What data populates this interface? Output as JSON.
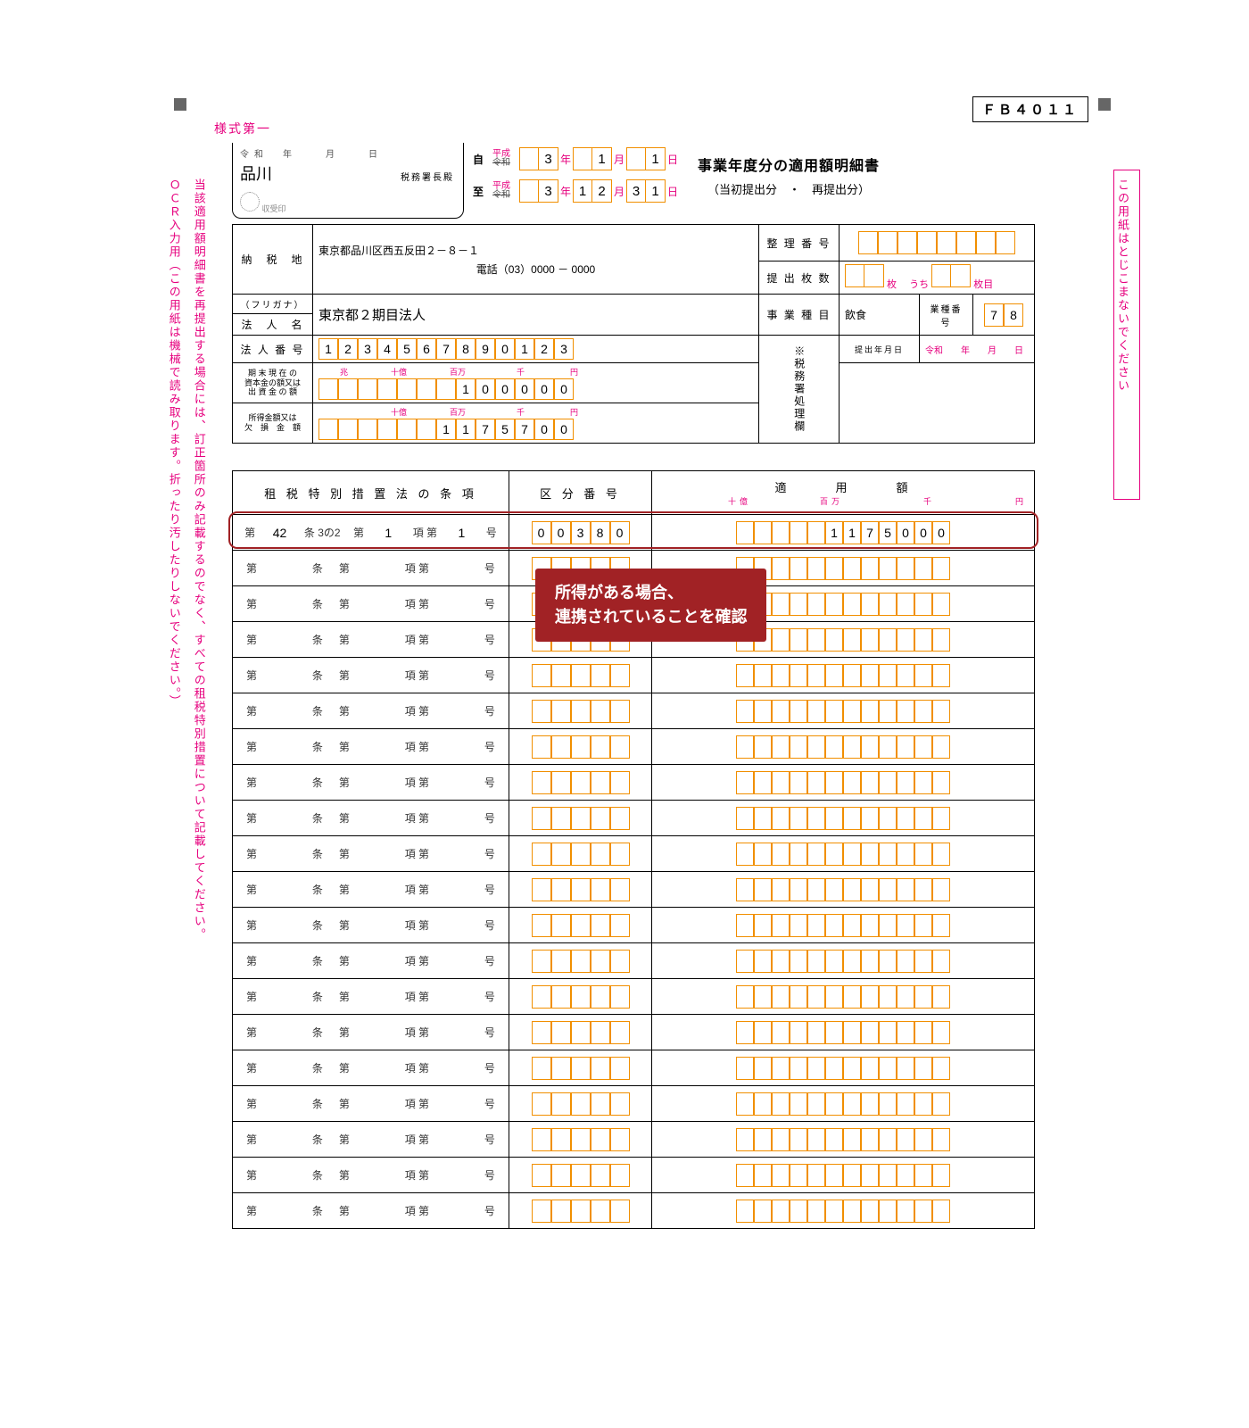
{
  "meta": {
    "form_id": "ＦＢ４０１１",
    "style_no": "様式第一"
  },
  "side_notes": {
    "left_line1": "当該適用額明細書を再提出する場合には、訂正箇所のみ記載するのでなく、すべての租税特別措置について記載してください。",
    "left_line2": "ＯＣＲ入力用（この用紙は機械で読み取ります。折ったり汚したりしないでください。）",
    "right": "この用紙はとじこまないでください"
  },
  "header": {
    "reiwa": "令和",
    "tiny_labels": "年　　月　　日",
    "office": "品川",
    "office_suffix": "税務署長殿",
    "stamp_label": "収受印",
    "from_label": "自",
    "to_label": "至",
    "era_heisei": "平成",
    "era_reiwa": "令和",
    "year_label": "年",
    "month_label": "月",
    "day_label": "日",
    "from": {
      "y1": "",
      "y2": "3",
      "m1": "",
      "m2": "1",
      "d1": "",
      "d2": "1"
    },
    "to": {
      "y1": "",
      "y2": "3",
      "m1": "1",
      "m2": "2",
      "d1": "3",
      "d2": "1"
    },
    "title": "事業年度分の適用額明細書",
    "subtitle": "（当初提出分　・　再提出分）"
  },
  "info": {
    "addr_label": "納　税　地",
    "address_line1": "東京都品川区西五反田２－８－１",
    "phone_label": "電話（",
    "phone_area": "03",
    "phone_mid": "）0000",
    "phone_dash": " － ",
    "phone_last": "0000",
    "furigana_label": "（フリガナ）",
    "furigana": "",
    "name_label": "法　人　名",
    "name": "東京都２期目法人",
    "corp_no_label": "法 人 番 号",
    "corp_no": [
      "1",
      "2",
      "3",
      "4",
      "5",
      "6",
      "7",
      "8",
      "9",
      "0",
      "1",
      "2",
      "3"
    ],
    "capital_label": "期 末 現 在 の\n資本金の額又は\n出 資 金 の 額",
    "capital_units": {
      "ju": "十億",
      "hyaku": "百万",
      "sen": "千",
      "en": "円",
      "oku": "兆"
    },
    "capital": [
      "",
      "",
      "",
      "",
      "",
      "",
      "",
      "1",
      "0",
      "0",
      "0",
      "0",
      "0"
    ],
    "income_label": "所得金額又は\n欠　損　金　額",
    "income": [
      "",
      "",
      "",
      "",
      "",
      "",
      "1",
      "1",
      "7",
      "5",
      "7",
      "0",
      "0"
    ],
    "docno_label": "整 理 番 号",
    "copies_label": "提 出 枚 数",
    "copies_unit1": "枚",
    "copies_uchi": "うち",
    "copies_unit2": "枚目",
    "biz_label": "事 業 種 目",
    "biz_value": "飲食",
    "biz_code_label": "業種番号",
    "biz_code": [
      "7",
      "8"
    ],
    "proc_label": "※税務署処理欄",
    "submit_date_label": "提出年月日",
    "submit_era": "令和",
    "submit_y": "年",
    "submit_m": "月",
    "submit_d": "日"
  },
  "lower": {
    "head_clause": "租 税 特 別 措 置 法 の 条 項",
    "head_kubun": "区 分 番 号",
    "head_amount": "適　　　用　　　額",
    "amount_units": [
      "十億",
      "百万",
      "千",
      "円"
    ],
    "clause_labels": {
      "dai1": "第",
      "jo": "条",
      "dai2": "第",
      "ko": "項 第",
      "go": "号"
    },
    "rows": [
      {
        "jo": "42",
        "jo_suffix": "3の2",
        "dai": "1",
        "ko": "1",
        "kubun": [
          "0",
          "0",
          "3",
          "8",
          "0"
        ],
        "amount": [
          "",
          "",
          "",
          "",
          "",
          "1",
          "1",
          "7",
          "5",
          "0",
          "0",
          "0"
        ]
      },
      {
        "jo": "",
        "jo_suffix": "",
        "dai": "",
        "ko": "",
        "kubun": [
          "",
          "",
          "",
          "",
          ""
        ],
        "amount": [
          "",
          "",
          "",
          "",
          "",
          "",
          "",
          "",
          "",
          "",
          "",
          ""
        ]
      },
      {
        "jo": "",
        "jo_suffix": "",
        "dai": "",
        "ko": "",
        "kubun": [
          "",
          "",
          "",
          "",
          ""
        ],
        "amount": [
          "",
          "",
          "",
          "",
          "",
          "",
          "",
          "",
          "",
          "",
          "",
          ""
        ]
      },
      {
        "jo": "",
        "jo_suffix": "",
        "dai": "",
        "ko": "",
        "kubun": [
          "",
          "",
          "",
          "",
          ""
        ],
        "amount": [
          "",
          "",
          "",
          "",
          "",
          "",
          "",
          "",
          "",
          "",
          "",
          ""
        ]
      },
      {
        "jo": "",
        "jo_suffix": "",
        "dai": "",
        "ko": "",
        "kubun": [
          "",
          "",
          "",
          "",
          ""
        ],
        "amount": [
          "",
          "",
          "",
          "",
          "",
          "",
          "",
          "",
          "",
          "",
          "",
          ""
        ]
      },
      {
        "jo": "",
        "jo_suffix": "",
        "dai": "",
        "ko": "",
        "kubun": [
          "",
          "",
          "",
          "",
          ""
        ],
        "amount": [
          "",
          "",
          "",
          "",
          "",
          "",
          "",
          "",
          "",
          "",
          "",
          ""
        ]
      },
      {
        "jo": "",
        "jo_suffix": "",
        "dai": "",
        "ko": "",
        "kubun": [
          "",
          "",
          "",
          "",
          ""
        ],
        "amount": [
          "",
          "",
          "",
          "",
          "",
          "",
          "",
          "",
          "",
          "",
          "",
          ""
        ]
      },
      {
        "jo": "",
        "jo_suffix": "",
        "dai": "",
        "ko": "",
        "kubun": [
          "",
          "",
          "",
          "",
          ""
        ],
        "amount": [
          "",
          "",
          "",
          "",
          "",
          "",
          "",
          "",
          "",
          "",
          "",
          ""
        ]
      },
      {
        "jo": "",
        "jo_suffix": "",
        "dai": "",
        "ko": "",
        "kubun": [
          "",
          "",
          "",
          "",
          ""
        ],
        "amount": [
          "",
          "",
          "",
          "",
          "",
          "",
          "",
          "",
          "",
          "",
          "",
          ""
        ]
      },
      {
        "jo": "",
        "jo_suffix": "",
        "dai": "",
        "ko": "",
        "kubun": [
          "",
          "",
          "",
          "",
          ""
        ],
        "amount": [
          "",
          "",
          "",
          "",
          "",
          "",
          "",
          "",
          "",
          "",
          "",
          ""
        ]
      },
      {
        "jo": "",
        "jo_suffix": "",
        "dai": "",
        "ko": "",
        "kubun": [
          "",
          "",
          "",
          "",
          ""
        ],
        "amount": [
          "",
          "",
          "",
          "",
          "",
          "",
          "",
          "",
          "",
          "",
          "",
          ""
        ]
      },
      {
        "jo": "",
        "jo_suffix": "",
        "dai": "",
        "ko": "",
        "kubun": [
          "",
          "",
          "",
          "",
          ""
        ],
        "amount": [
          "",
          "",
          "",
          "",
          "",
          "",
          "",
          "",
          "",
          "",
          "",
          ""
        ]
      },
      {
        "jo": "",
        "jo_suffix": "",
        "dai": "",
        "ko": "",
        "kubun": [
          "",
          "",
          "",
          "",
          ""
        ],
        "amount": [
          "",
          "",
          "",
          "",
          "",
          "",
          "",
          "",
          "",
          "",
          "",
          ""
        ]
      },
      {
        "jo": "",
        "jo_suffix": "",
        "dai": "",
        "ko": "",
        "kubun": [
          "",
          "",
          "",
          "",
          ""
        ],
        "amount": [
          "",
          "",
          "",
          "",
          "",
          "",
          "",
          "",
          "",
          "",
          "",
          ""
        ]
      },
      {
        "jo": "",
        "jo_suffix": "",
        "dai": "",
        "ko": "",
        "kubun": [
          "",
          "",
          "",
          "",
          ""
        ],
        "amount": [
          "",
          "",
          "",
          "",
          "",
          "",
          "",
          "",
          "",
          "",
          "",
          ""
        ]
      },
      {
        "jo": "",
        "jo_suffix": "",
        "dai": "",
        "ko": "",
        "kubun": [
          "",
          "",
          "",
          "",
          ""
        ],
        "amount": [
          "",
          "",
          "",
          "",
          "",
          "",
          "",
          "",
          "",
          "",
          "",
          ""
        ]
      },
      {
        "jo": "",
        "jo_suffix": "",
        "dai": "",
        "ko": "",
        "kubun": [
          "",
          "",
          "",
          "",
          ""
        ],
        "amount": [
          "",
          "",
          "",
          "",
          "",
          "",
          "",
          "",
          "",
          "",
          "",
          ""
        ]
      },
      {
        "jo": "",
        "jo_suffix": "",
        "dai": "",
        "ko": "",
        "kubun": [
          "",
          "",
          "",
          "",
          ""
        ],
        "amount": [
          "",
          "",
          "",
          "",
          "",
          "",
          "",
          "",
          "",
          "",
          "",
          ""
        ]
      },
      {
        "jo": "",
        "jo_suffix": "",
        "dai": "",
        "ko": "",
        "kubun": [
          "",
          "",
          "",
          "",
          ""
        ],
        "amount": [
          "",
          "",
          "",
          "",
          "",
          "",
          "",
          "",
          "",
          "",
          "",
          ""
        ]
      },
      {
        "jo": "",
        "jo_suffix": "",
        "dai": "",
        "ko": "",
        "kubun": [
          "",
          "",
          "",
          "",
          ""
        ],
        "amount": [
          "",
          "",
          "",
          "",
          "",
          "",
          "",
          "",
          "",
          "",
          "",
          ""
        ]
      }
    ]
  },
  "callout": {
    "line1": "所得がある場合、",
    "line2": "連携されていることを確認"
  }
}
